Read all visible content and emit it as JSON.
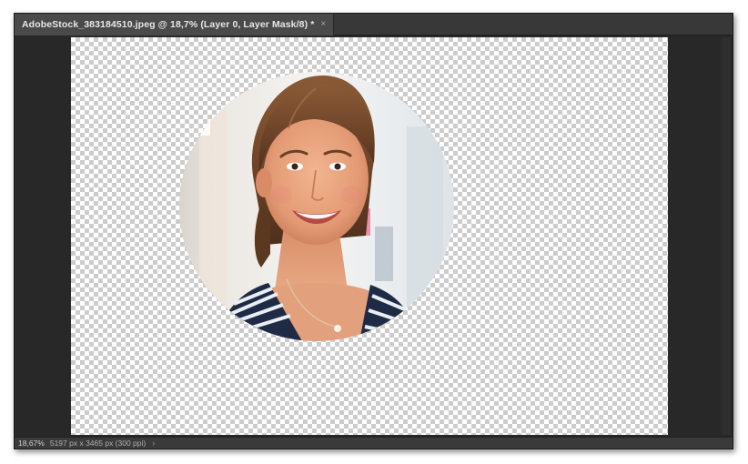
{
  "document_tab": {
    "title": "AdobeStock_383184510.jpeg @ 18,7% (Layer 0, Layer Mask/8) *",
    "close_glyph": "×"
  },
  "statusbar": {
    "zoom": "18,67%",
    "doc_info": "5197 px x 3465 px (300 ppi)",
    "arrow_glyph": "›"
  },
  "icons": {
    "tab_close": "close-icon",
    "status_menu": "chevron-right-icon"
  },
  "colors": {
    "workspace": "#282828",
    "tab_active": "#4a4a4a",
    "checker_light": "#ffffff",
    "checker_dark": "#cccccc"
  }
}
